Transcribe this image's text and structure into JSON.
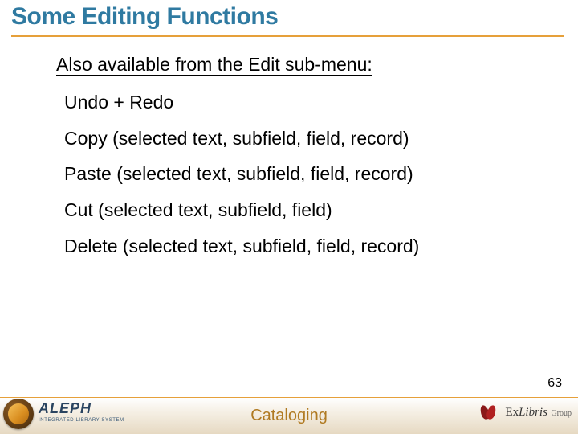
{
  "title": "Some Editing Functions",
  "intro": {
    "pre": "Also available from the ",
    "underlined": "Edit",
    "post": " sub-menu:"
  },
  "items": [
    "Undo + Redo",
    "Copy (selected text, subfield, field, record)",
    "Paste (selected text, subfield, field, record)",
    "Cut (selected text, subfield, field)",
    "Delete (selected text, subfield, field, record)"
  ],
  "page_number": "63",
  "footer": {
    "center": "Cataloging",
    "aleph": {
      "name": "ALEPH",
      "tag": "INTEGRATED LIBRARY SYSTEM"
    },
    "exlibris": {
      "brand_ex": "Ex",
      "brand_libris": "Libris",
      "brand_group": " Group"
    }
  },
  "colors": {
    "title": "#2f7aa1",
    "rule": "#e6a03a",
    "footer_text": "#b07a22"
  }
}
